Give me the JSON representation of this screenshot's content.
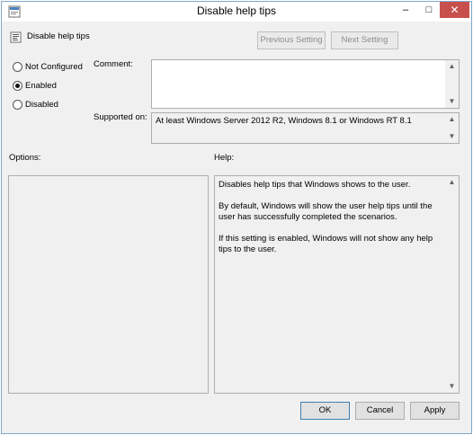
{
  "window": {
    "title": "Disable help tips",
    "controls": {
      "minimize": "–",
      "maximize": "□",
      "close": "✕"
    }
  },
  "header": {
    "policy_name": "Disable help tips"
  },
  "nav": {
    "previous_label": "Previous Setting",
    "next_label": "Next Setting"
  },
  "state": {
    "options": [
      {
        "label": "Not Configured",
        "selected": false
      },
      {
        "label": "Enabled",
        "selected": true
      },
      {
        "label": "Disabled",
        "selected": false
      }
    ]
  },
  "comment": {
    "label": "Comment:",
    "value": ""
  },
  "supported": {
    "label": "Supported on:",
    "value": "At least Windows Server 2012 R2, Windows 8.1 or Windows RT 8.1"
  },
  "options_panel": {
    "label": "Options:"
  },
  "help_panel": {
    "label": "Help:",
    "paragraphs": [
      "Disables help tips that Windows shows to the user.",
      "By default, Windows will show the user help tips until the user has successfully completed the scenarios.",
      "If this setting is enabled, Windows will not show any help tips to the user."
    ]
  },
  "footer": {
    "ok_label": "OK",
    "cancel_label": "Cancel",
    "apply_label": "Apply"
  },
  "icons": {
    "scroll_up": "▲",
    "scroll_down": "▼"
  },
  "colors": {
    "close_button": "#c7504c",
    "window_border": "#7fa7cc",
    "dialog_bg": "#f0f0f0"
  }
}
